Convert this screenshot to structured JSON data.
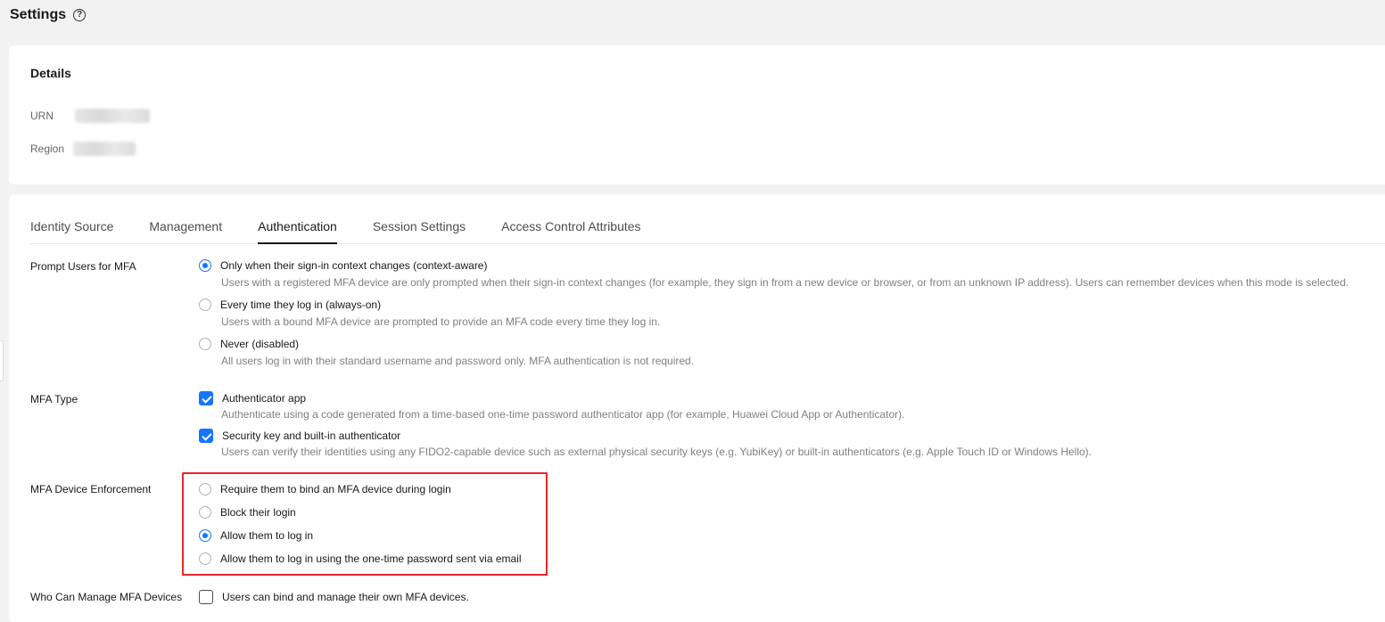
{
  "header": {
    "title": "Settings",
    "help_glyph": "?"
  },
  "details": {
    "title": "Details",
    "urn_label": "URN",
    "region_label": "Region"
  },
  "tabs": [
    {
      "label": "Identity Source"
    },
    {
      "label": "Management"
    },
    {
      "label": "Authentication",
      "active": true
    },
    {
      "label": "Session Settings"
    },
    {
      "label": "Access Control Attributes"
    }
  ],
  "prompt_mfa": {
    "label": "Prompt Users for MFA",
    "options": [
      {
        "label": "Only when their sign-in context changes (context-aware)",
        "desc": "Users with a registered MFA device are only prompted when their sign-in context changes (for example, they sign in from a new device or browser, or from an unknown IP address). Users can remember devices when this mode is selected.",
        "checked": true
      },
      {
        "label": "Every time they log in (always-on)",
        "desc": "Users with a bound MFA device are prompted to provide an MFA code every time they log in.",
        "checked": false
      },
      {
        "label": "Never (disabled)",
        "desc": "All users log in with their standard username and password only. MFA authentication is not required.",
        "checked": false
      }
    ]
  },
  "mfa_type": {
    "label": "MFA Type",
    "options": [
      {
        "label": "Authenticator app",
        "desc": "Authenticate using a code generated from a time-based one-time password authenticator app (for example, Huawei Cloud App or Authenticator).",
        "checked": true
      },
      {
        "label": "Security key and built-in authenticator",
        "desc": "Users can verify their identities using any FIDO2-capable device such as external physical security keys (e.g. YubiKey) or built-in authenticators (e.g. Apple Touch ID or Windows Hello).",
        "checked": true
      }
    ]
  },
  "enforcement": {
    "label": "MFA Device Enforcement",
    "options": [
      {
        "label": "Require them to bind an MFA device during login",
        "checked": false
      },
      {
        "label": "Block their login",
        "checked": false
      },
      {
        "label": "Allow them to log in",
        "checked": true
      },
      {
        "label": "Allow them to log in using the one-time password sent via email",
        "checked": false
      }
    ]
  },
  "manage_devices": {
    "label": "Who Can Manage MFA Devices",
    "option_label": "Users can bind and manage their own MFA devices.",
    "checked": false
  },
  "colors": {
    "accent": "#1476ff",
    "highlight": "#e5272d"
  }
}
